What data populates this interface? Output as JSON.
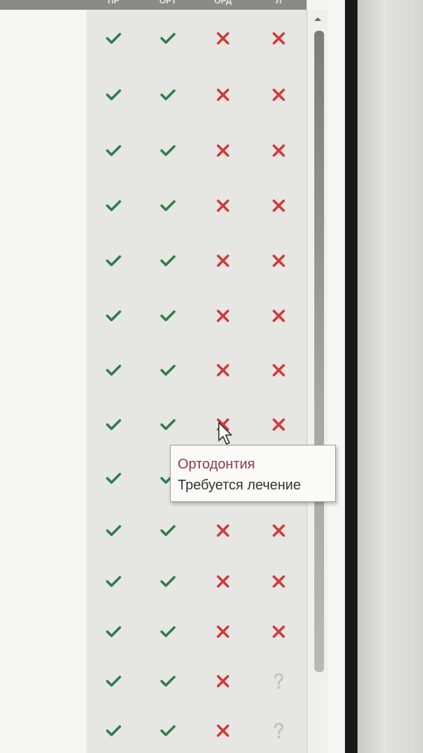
{
  "table": {
    "header": [
      "ПР",
      "ОРТ",
      "ОРД",
      "Л"
    ],
    "rows": [
      {
        "cells": [
          "check",
          "check",
          "cross",
          "cross"
        ]
      },
      {
        "cells": [
          "check",
          "check",
          "cross",
          "cross"
        ]
      },
      {
        "cells": [
          "check",
          "check",
          "cross",
          "cross"
        ]
      },
      {
        "cells": [
          "check",
          "check",
          "cross",
          "cross"
        ]
      },
      {
        "cells": [
          "check",
          "check",
          "cross",
          "cross"
        ]
      },
      {
        "cells": [
          "check",
          "check",
          "cross",
          "cross"
        ]
      },
      {
        "cells": [
          "check",
          "check",
          "cross",
          "cross"
        ]
      },
      {
        "cells": [
          "check",
          "check",
          "cross",
          "cross"
        ]
      },
      {
        "cells": [
          "check",
          "check",
          "",
          ""
        ]
      },
      {
        "cells": [
          "check",
          "check",
          "cross",
          "cross"
        ]
      },
      {
        "cells": [
          "check",
          "check",
          "cross",
          "cross"
        ]
      },
      {
        "cells": [
          "check",
          "check",
          "cross",
          "cross"
        ]
      },
      {
        "cells": [
          "check",
          "check",
          "cross",
          "question"
        ]
      },
      {
        "cells": [
          "check",
          "check",
          "cross",
          "question"
        ]
      }
    ]
  },
  "tooltip": {
    "title": "Ортодонтия",
    "text": "Требуется лечение"
  },
  "colors": {
    "check": "#2e7d4a",
    "cross": "#d03a3a",
    "question": "#c4c4c0"
  },
  "icons": {
    "check": "check-icon",
    "cross": "cross-icon",
    "question": "question-icon",
    "cursor": "mouse-pointer-icon",
    "scroll_up": "scroll-up-arrow-icon"
  }
}
